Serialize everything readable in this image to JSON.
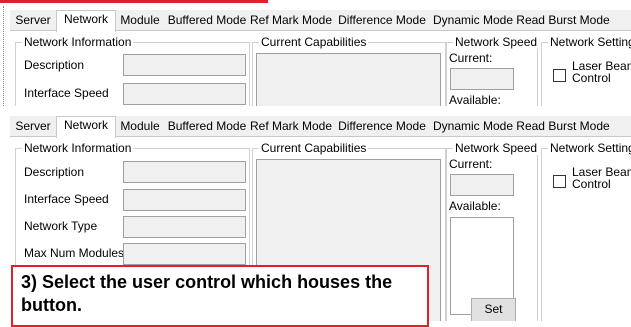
{
  "top_panel": {
    "tabs": [
      {
        "label": "Server"
      },
      {
        "label": "Network"
      },
      {
        "label": "Module"
      },
      {
        "label": "Buffered Mode"
      },
      {
        "label": "Ref Mark Mode"
      },
      {
        "label": "Difference Mode"
      },
      {
        "label": "Dynamic Mode"
      },
      {
        "label": "Read Burst Mode"
      }
    ],
    "active_tab": "Network",
    "network_information": {
      "title": "Network Information",
      "description_label": "Description",
      "interface_speed_label": "Interface Speed"
    },
    "current_capabilities_title": "Current Capabilities",
    "network_speed": {
      "title": "Network Speed",
      "current_label": "Current:",
      "available_label": "Available:"
    },
    "network_settings": {
      "title": "Network Settings",
      "laser_beam_label_line1": "Laser Beam",
      "laser_beam_label_line2": "Control"
    }
  },
  "bottom_panel": {
    "tabs": [
      {
        "label": "Server"
      },
      {
        "label": "Network"
      },
      {
        "label": "Module"
      },
      {
        "label": "Buffered Mode"
      },
      {
        "label": "Ref Mark Mode"
      },
      {
        "label": "Difference Mode"
      },
      {
        "label": "Dynamic Mode"
      },
      {
        "label": "Read Burst Mode"
      }
    ],
    "active_tab": "Network",
    "network_information": {
      "title": "Network Information",
      "description_label": "Description",
      "interface_speed_label": "Interface Speed",
      "network_type_label": "Network Type",
      "max_num_modules_label": "Max Num Modules"
    },
    "current_capabilities_title": "Current Capabilities",
    "network_speed": {
      "title": "Network Speed",
      "current_label": "Current:",
      "available_label": "Available:",
      "set_button": "Set"
    },
    "network_settings": {
      "title": "Network Settings",
      "laser_beam_label_line1": "Laser Beam",
      "laser_beam_label_line2": "Control"
    }
  },
  "callout": {
    "line1": "3) Select the user control which houses the",
    "line2": "button."
  },
  "colors": {
    "callout_border": "#e0202c",
    "panel_background": "#f0f0f0"
  }
}
